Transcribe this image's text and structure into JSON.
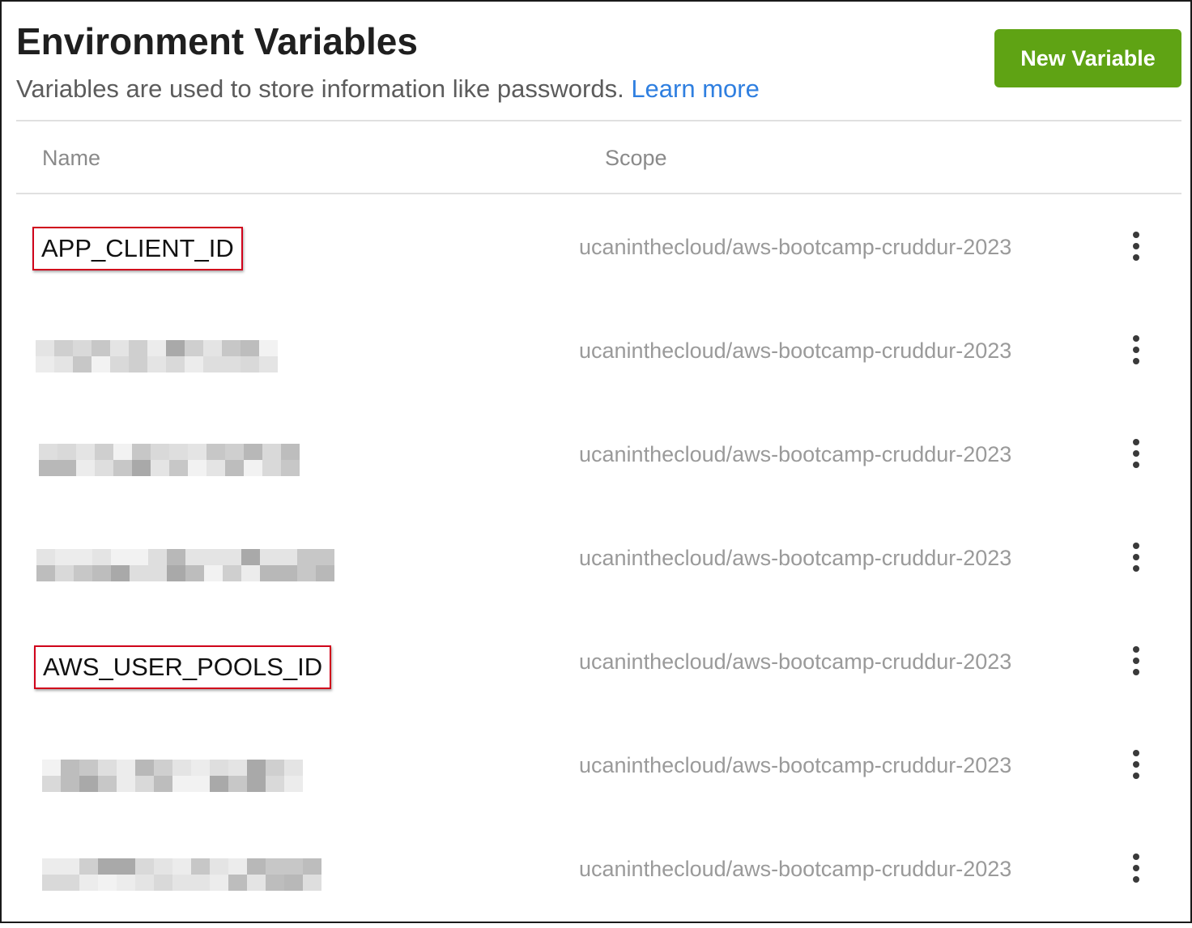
{
  "header": {
    "title": "Environment Variables",
    "subtitle": "Variables are used to store information like passwords.",
    "learn_more": "Learn more",
    "new_button": "New Variable"
  },
  "table": {
    "columns": [
      "Name",
      "Scope"
    ],
    "rows": [
      {
        "name": "APP_CLIENT_ID",
        "scope": "ucaninthecloud/aws-bootcamp-cruddur-2023",
        "highlighted": true,
        "redacted": false
      },
      {
        "name": "",
        "scope": "ucaninthecloud/aws-bootcamp-cruddur-2023",
        "highlighted": false,
        "redacted": true
      },
      {
        "name": "",
        "scope": "ucaninthecloud/aws-bootcamp-cruddur-2023",
        "highlighted": false,
        "redacted": true
      },
      {
        "name": "",
        "scope": "ucaninthecloud/aws-bootcamp-cruddur-2023",
        "highlighted": false,
        "redacted": true
      },
      {
        "name": "AWS_USER_POOLS_ID",
        "scope": "ucaninthecloud/aws-bootcamp-cruddur-2023",
        "highlighted": true,
        "redacted": false
      },
      {
        "name": "",
        "scope": "ucaninthecloud/aws-bootcamp-cruddur-2023",
        "highlighted": false,
        "redacted": true
      },
      {
        "name": "",
        "scope": "ucaninthecloud/aws-bootcamp-cruddur-2023",
        "highlighted": false,
        "redacted": true
      }
    ]
  },
  "icons": {
    "row_menu": "more-vertical-icon"
  },
  "colors": {
    "primary_button": "#5fa314",
    "link": "#2f7fe0",
    "highlight_border": "#d0021b"
  }
}
